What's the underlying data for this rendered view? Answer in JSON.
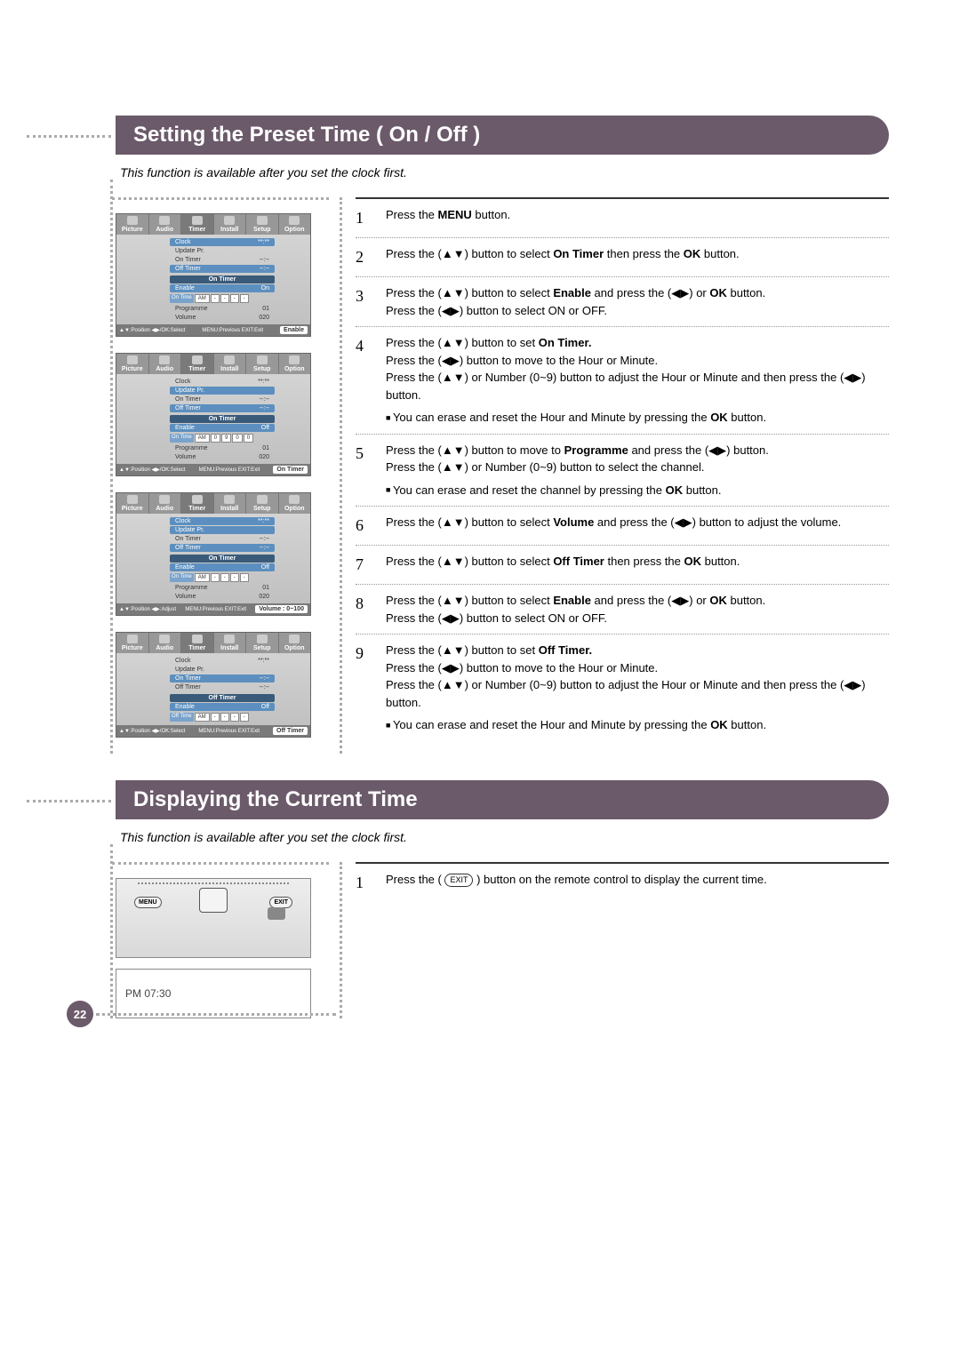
{
  "page_number": "22",
  "section1": {
    "title": "Setting the Preset Time ( On / Off )",
    "subtitle": "This function is available after you set the clock first.",
    "osd_tabs": [
      "Picture",
      "Audio",
      "Timer",
      "Install",
      "Setup",
      "Option"
    ],
    "osd_menu_items": {
      "clock": "Clock",
      "clock_val": "**:**",
      "update": "Update Pr.",
      "on_timer": "On Timer",
      "on_timer_val": "--:--",
      "off_timer": "Off Timer",
      "off_timer_val": "--:--"
    },
    "osd_panels": [
      {
        "header": "On Timer",
        "highlight_row": {
          "label": "Enable",
          "value": "On"
        },
        "time_label": "On Time",
        "time_cells": [
          "AM",
          "-",
          "-",
          "-",
          "-"
        ],
        "rows": [
          {
            "label": "Programme",
            "value": "01"
          },
          {
            "label": "Volume",
            "value": "020"
          }
        ],
        "footer_left": "▲▼:Position ◀▶/OK:Select",
        "footer_right": "MENU:Previous EXIT:Exit",
        "badge": "Enable"
      },
      {
        "header": "On Timer",
        "highlight_row": {
          "label": "Enable",
          "value": "Off"
        },
        "time_label": "On Time",
        "time_cells": [
          "AM",
          "0",
          "9",
          "0",
          "0"
        ],
        "rows": [
          {
            "label": "Programme",
            "value": "01"
          },
          {
            "label": "Volume",
            "value": "020"
          }
        ],
        "footer_left": "▲▼:Position ◀▶/OK:Select",
        "footer_right": "MENU:Previous EXIT:Exit",
        "badge": "On Timer"
      },
      {
        "header": "On Timer",
        "highlight_row": {
          "label": "Enable",
          "value": "Off"
        },
        "time_label": "On Time",
        "time_cells": [
          "AM",
          "-",
          "-",
          "-",
          "-"
        ],
        "rows": [
          {
            "label": "Programme",
            "value": "01"
          },
          {
            "label": "Volume",
            "value": "020"
          }
        ],
        "footer_left": "▲▼:Position ◀▶:Adjust",
        "footer_right": "MENU:Previous EXIT:Exit",
        "badge": "Volume : 0~100"
      },
      {
        "header": "Off Timer",
        "highlight_row": {
          "label": "Enable",
          "value": "Off"
        },
        "time_label": "Off Time",
        "time_cells": [
          "AM",
          "-",
          "-",
          "-",
          "-"
        ],
        "rows": [],
        "footer_left": "▲▼:Position ◀▶/OK:Select",
        "footer_right": "MENU:Previous EXIT:Exit",
        "badge": "Off Timer"
      }
    ],
    "steps": {
      "s1": {
        "n": "1",
        "text_a": "Press the ",
        "b1": "MENU",
        "text_b": " button."
      },
      "s2": {
        "n": "2",
        "text_a": "Press the (▲▼) button to select ",
        "b1": "On Timer",
        "text_b": " then press the ",
        "b2": "OK",
        "text_c": " button."
      },
      "s3": {
        "n": "3",
        "text_a": "Press the (▲▼) button to select ",
        "b1": "Enable",
        "text_b": " and press the (◀▶) or ",
        "b2": "OK",
        "text_c": " button.",
        "line2": "Press the (◀▶) button to select ON or OFF."
      },
      "s4": {
        "n": "4",
        "text_a": "Press the (▲▼) button to set ",
        "b1": "On Timer.",
        "line2": "Press the (◀▶) button to move to the Hour or Minute.",
        "line3": "Press the (▲▼) or Number (0~9) button to adjust the Hour or Minute and then press the  (◀▶) button.",
        "note_a": "You can erase and reset the Hour and Minute by pressing the ",
        "note_b": "OK",
        "note_c": " button."
      },
      "s5": {
        "n": "5",
        "text_a": "Press the (▲▼) button to move to ",
        "b1": "Programme",
        "text_b": "  and press the (◀▶) button.",
        "line2": "Press the (▲▼) or Number (0~9) button to select the channel.",
        "note_a": "You can erase and reset the channel by pressing the ",
        "note_b": "OK",
        "note_c": " button."
      },
      "s6": {
        "n": "6",
        "text_a": "Press the (▲▼) button to select ",
        "b1": "Volume",
        "text_b": " and press the (◀▶) button to adjust the volume."
      },
      "s7": {
        "n": "7",
        "text_a": "Press the (▲▼) button to select ",
        "b1": "Off Timer",
        "text_b": " then press the ",
        "b2": "OK",
        "text_c": " button."
      },
      "s8": {
        "n": "8",
        "text_a": "Press the (▲▼) button to select ",
        "b1": "Enable",
        "text_b": " and press the (◀▶) or ",
        "b2": "OK",
        "text_c": " button.",
        "line2": "Press the (◀▶) button to select ON or OFF."
      },
      "s9": {
        "n": "9",
        "text_a": "Press the (▲▼) button to set ",
        "b1": "Off Timer.",
        "line2": "Press the (◀▶) button to move to the Hour or Minute.",
        "line3": "Press the (▲▼) or Number (0~9) button to adjust the Hour or Minute and then press the  (◀▶) button.",
        "note_a": "You can erase and reset the Hour and Minute by pressing the ",
        "note_b": "OK",
        "note_c": " button."
      }
    }
  },
  "section2": {
    "title": "Displaying the Current Time",
    "subtitle": "This function is available after you set the clock first.",
    "remote": {
      "menu": "MENU",
      "exit": "EXIT"
    },
    "time_display": "PM 07:30",
    "step": {
      "n": "1",
      "text_a": "Press the ( ",
      "chip": "EXIT",
      "text_b": " ) button on the remote control to display the current time."
    }
  }
}
